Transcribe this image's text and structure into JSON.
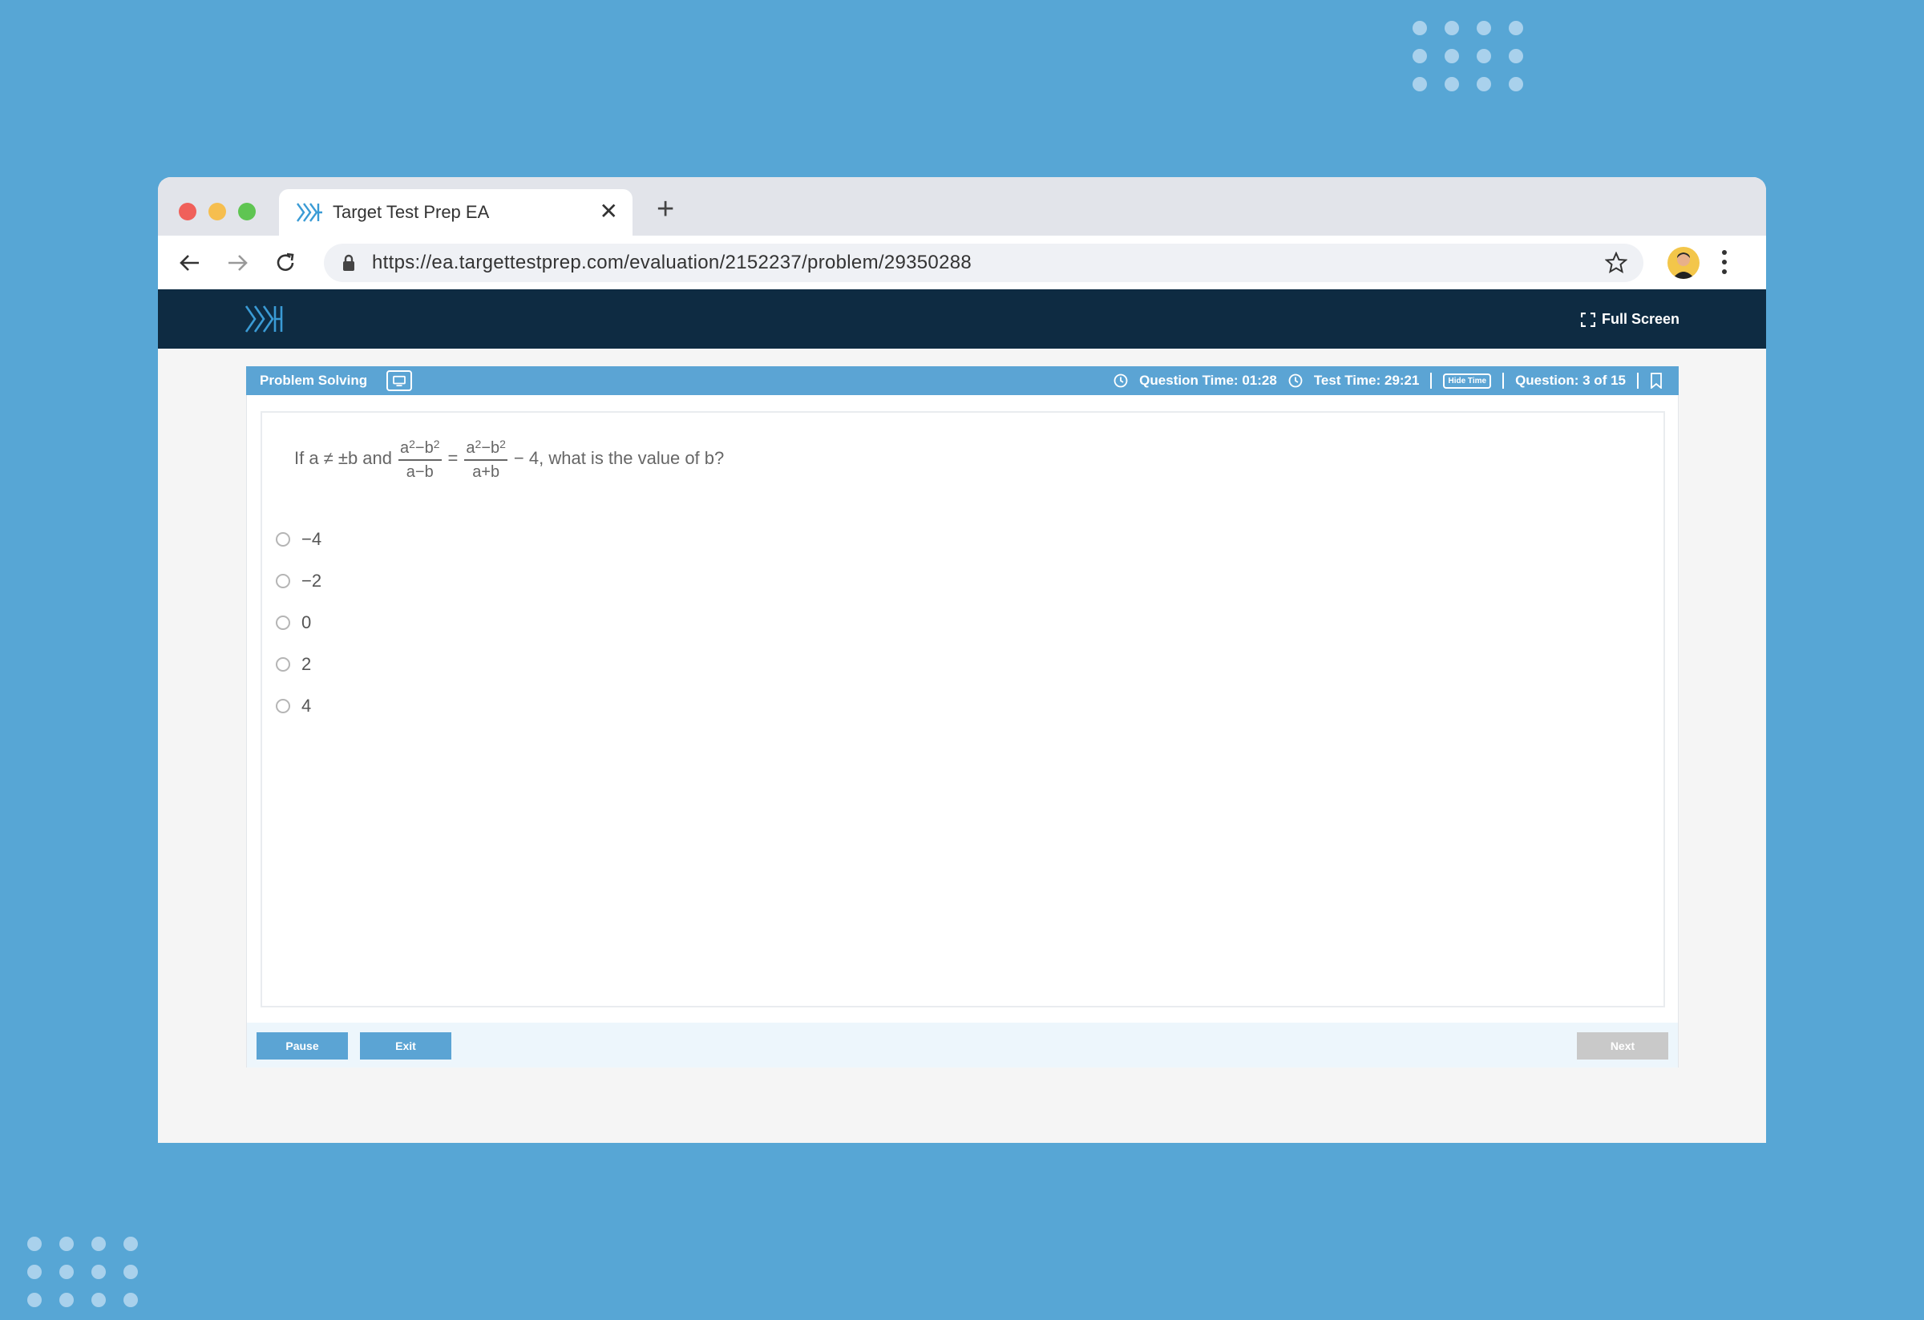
{
  "browser": {
    "tab_title": "Target Test Prep EA",
    "url": "https://ea.targettestprep.com/evaluation/2152237/problem/29350288"
  },
  "app": {
    "fullscreen_label": "Full Screen"
  },
  "question_bar": {
    "type": "Problem Solving",
    "question_time": "Question Time: 01:28",
    "test_time": "Test Time: 29:21",
    "hide_time": "Hide Time",
    "question_count": "Question: 3 of 15"
  },
  "question": {
    "prefix": "If a ≠ ±b and",
    "frac1_num_a": "a",
    "frac1_num_exp1": "2",
    "frac1_num_mid": "−b",
    "frac1_num_exp2": "2",
    "frac1_den": "a−b",
    "equals": "=",
    "frac2_num_a": "a",
    "frac2_num_exp1": "2",
    "frac2_num_mid": "−b",
    "frac2_num_exp2": "2",
    "frac2_den": "a+b",
    "suffix": "− 4, what is the value of b?"
  },
  "choices": [
    "−4",
    "−2",
    "0",
    "2",
    "4"
  ],
  "footer": {
    "pause": "Pause",
    "exit": "Exit",
    "next": "Next"
  }
}
